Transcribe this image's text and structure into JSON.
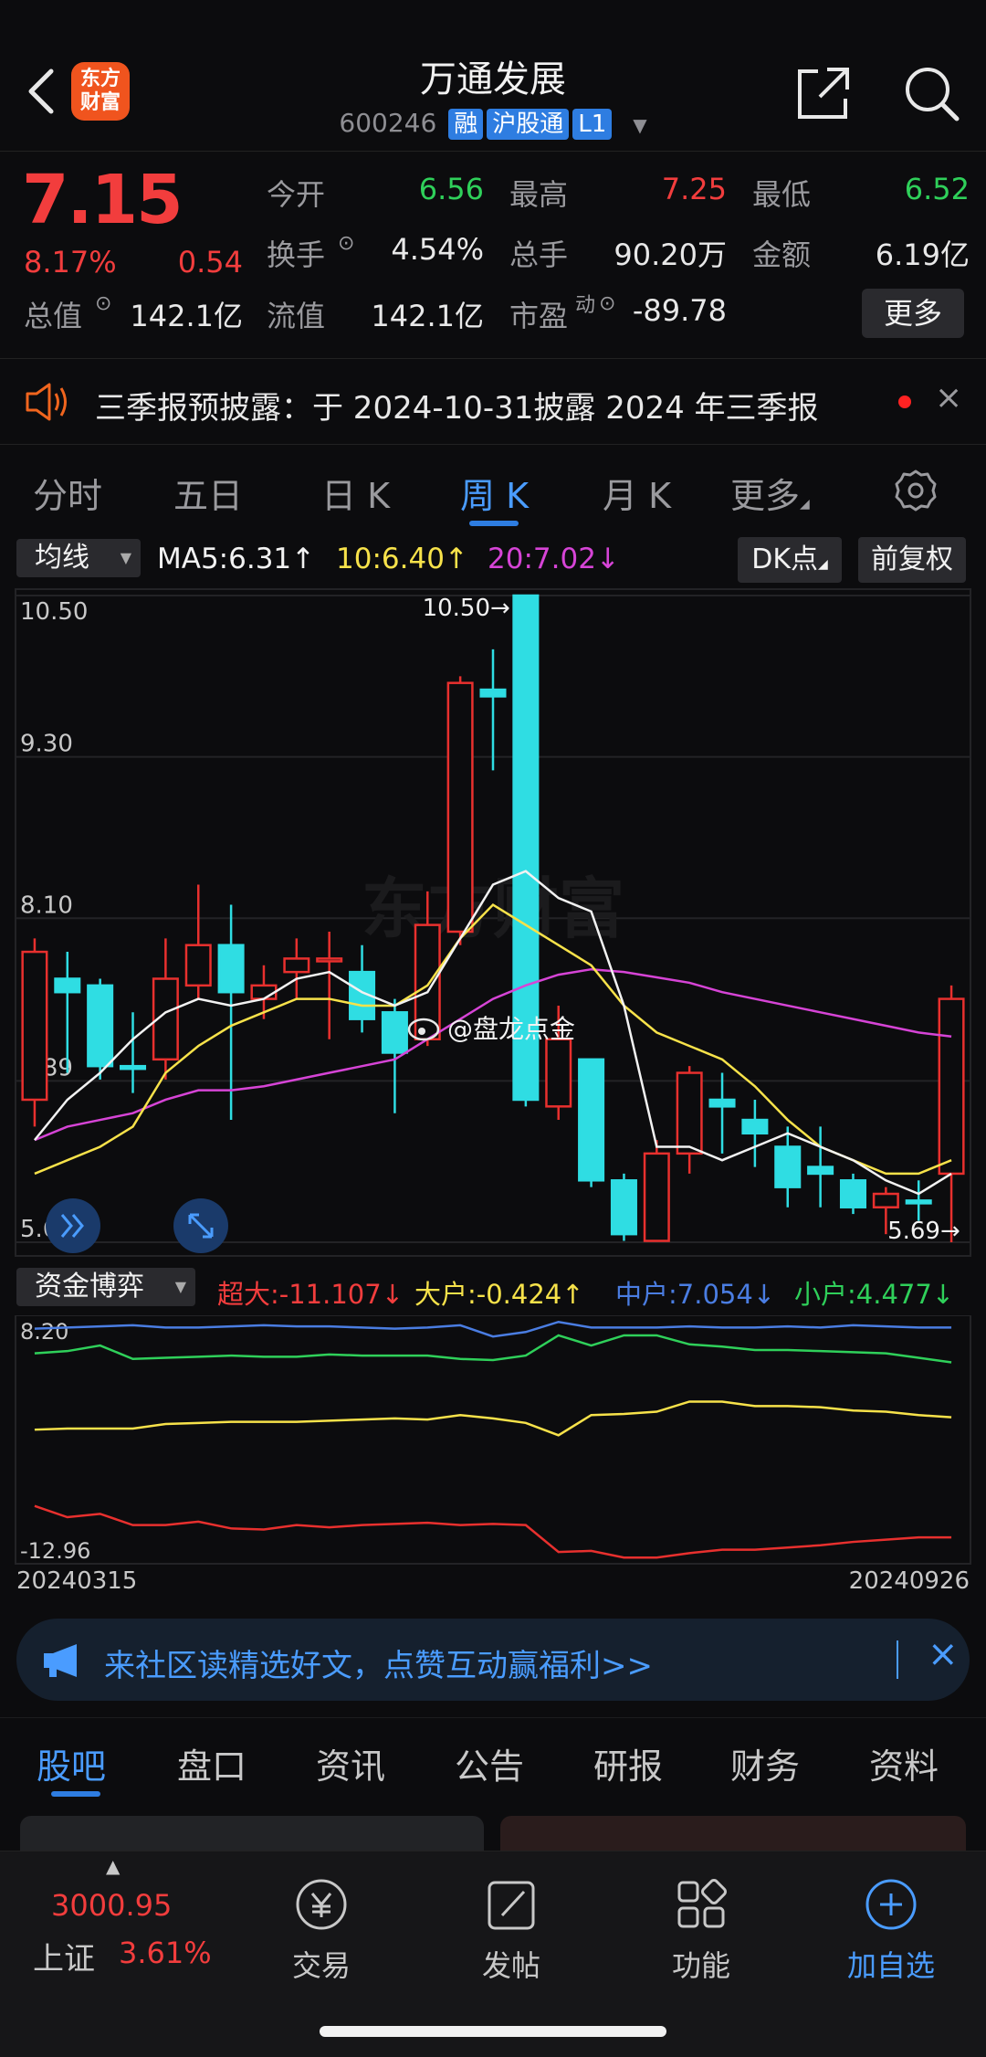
{
  "header": {
    "logo_line1": "东方",
    "logo_line2": "财富",
    "title": "万通发展",
    "code": "600246",
    "tags": [
      "融",
      "沪股通",
      "L1"
    ]
  },
  "quote": {
    "price": "7.15",
    "change_pct": "8.17%",
    "change": "0.54",
    "fields": [
      {
        "label": "今开",
        "value": "6.56",
        "color": "#2fd05a"
      },
      {
        "label": "最高",
        "value": "7.25",
        "color": "#f23d3d"
      },
      {
        "label": "最低",
        "value": "6.52",
        "color": "#2fd05a"
      },
      {
        "label": "换手",
        "value": "4.54%",
        "color": "#e8e8e8"
      },
      {
        "label": "总手",
        "value": "90.20万",
        "color": "#e8e8e8"
      },
      {
        "label": "金额",
        "value": "6.19亿",
        "color": "#e8e8e8"
      },
      {
        "label": "总值",
        "value": "142.1亿",
        "color": "#e8e8e8"
      },
      {
        "label": "流值",
        "value": "142.1亿",
        "color": "#e8e8e8"
      },
      {
        "label": "市盈",
        "value": "-89.78",
        "color": "#e8e8e8"
      }
    ],
    "pe_superscript": "动",
    "more_label": "更多"
  },
  "notice": {
    "text": "三季报预披露：于 2024-10-31披露 2024 年三季报"
  },
  "tabs": [
    {
      "label": "分时"
    },
    {
      "label": "五日"
    },
    {
      "label": "日 K"
    },
    {
      "label": "周 K"
    },
    {
      "label": "月 K"
    },
    {
      "label": "更多"
    }
  ],
  "legend": {
    "dropdown": "均线",
    "ma5": "MA5:6.31↑",
    "ma10": "10:6.40↑",
    "ma20": "20:7.02↓",
    "dk_label": "DK点",
    "adjust_label": "前复权"
  },
  "chart_data": {
    "type": "candlestick",
    "ylim": [
      5.69,
      10.5
    ],
    "y_ticks": [
      "10.50",
      "9.30",
      "8.10",
      "6.89",
      "5.69"
    ],
    "max_label": "10.50→",
    "min_label": "5.69→",
    "watermark": "东方财富",
    "weibo_tag": "@盘龙点金",
    "candles": [
      {
        "o": 6.75,
        "c": 7.85,
        "h": 7.95,
        "l": 6.55
      },
      {
        "o": 7.65,
        "c": 7.55,
        "h": 7.85,
        "l": 6.95
      },
      {
        "o": 7.6,
        "c": 7.0,
        "h": 7.65,
        "l": 6.9
      },
      {
        "o": 7.0,
        "c": 6.98,
        "h": 7.4,
        "l": 6.8
      },
      {
        "o": 7.05,
        "c": 7.65,
        "h": 7.95,
        "l": 6.9
      },
      {
        "o": 7.6,
        "c": 7.9,
        "h": 8.35,
        "l": 7.5
      },
      {
        "o": 7.9,
        "c": 7.55,
        "h": 8.2,
        "l": 6.6
      },
      {
        "o": 7.5,
        "c": 7.6,
        "h": 7.75,
        "l": 7.35
      },
      {
        "o": 7.7,
        "c": 7.8,
        "h": 7.95,
        "l": 7.5
      },
      {
        "o": 7.8,
        "c": 7.8,
        "h": 8.0,
        "l": 7.2
      },
      {
        "o": 7.7,
        "c": 7.35,
        "h": 7.9,
        "l": 7.25
      },
      {
        "o": 7.4,
        "c": 7.1,
        "h": 7.5,
        "l": 6.65
      },
      {
        "o": 7.2,
        "c": 8.05,
        "h": 8.3,
        "l": 7.15
      },
      {
        "o": 8.0,
        "c": 9.85,
        "h": 9.9,
        "l": 7.9
      },
      {
        "o": 9.8,
        "c": 9.75,
        "h": 10.1,
        "l": 9.2
      },
      {
        "o": 10.5,
        "c": 6.75,
        "h": 10.5,
        "l": 6.7
      },
      {
        "o": 6.7,
        "c": 7.2,
        "h": 7.45,
        "l": 6.6
      },
      {
        "o": 7.05,
        "c": 6.15,
        "h": 7.05,
        "l": 6.1
      },
      {
        "o": 6.15,
        "c": 5.75,
        "h": 6.2,
        "l": 5.7
      },
      {
        "o": 5.7,
        "c": 6.35,
        "h": 6.45,
        "l": 5.7
      },
      {
        "o": 6.35,
        "c": 6.95,
        "h": 7.0,
        "l": 6.2
      },
      {
        "o": 6.75,
        "c": 6.7,
        "h": 6.95,
        "l": 6.35
      },
      {
        "o": 6.6,
        "c": 6.5,
        "h": 6.75,
        "l": 6.25
      },
      {
        "o": 6.4,
        "c": 6.1,
        "h": 6.55,
        "l": 5.95
      },
      {
        "o": 6.25,
        "c": 6.2,
        "h": 6.55,
        "l": 5.95
      },
      {
        "o": 6.15,
        "c": 5.95,
        "h": 6.2,
        "l": 5.9
      },
      {
        "o": 5.95,
        "c": 6.05,
        "h": 6.1,
        "l": 5.75
      },
      {
        "o": 6.0,
        "c": 5.98,
        "h": 6.15,
        "l": 5.85
      },
      {
        "o": 6.2,
        "c": 7.5,
        "h": 7.6,
        "l": 5.69
      }
    ],
    "ma5": [
      6.45,
      6.75,
      6.95,
      7.2,
      7.4,
      7.5,
      7.45,
      7.5,
      7.65,
      7.7,
      7.55,
      7.45,
      7.55,
      7.95,
      8.35,
      8.45,
      8.25,
      8.15,
      7.45,
      6.4,
      6.4,
      6.3,
      6.4,
      6.5,
      6.4,
      6.3,
      6.15,
      6.05,
      6.2
    ],
    "ma10": [
      6.2,
      6.3,
      6.4,
      6.55,
      6.95,
      7.15,
      7.3,
      7.4,
      7.5,
      7.5,
      7.45,
      7.45,
      7.6,
      7.95,
      8.2,
      8.05,
      7.9,
      7.75,
      7.45,
      7.25,
      7.15,
      7.05,
      6.85,
      6.6,
      6.4,
      6.3,
      6.2,
      6.2,
      6.3
    ],
    "ma20": [
      6.45,
      6.55,
      6.6,
      6.65,
      6.75,
      6.82,
      6.82,
      6.85,
      6.9,
      6.95,
      7.0,
      7.05,
      7.2,
      7.35,
      7.5,
      7.6,
      7.68,
      7.72,
      7.7,
      7.66,
      7.62,
      7.55,
      7.5,
      7.45,
      7.4,
      7.35,
      7.3,
      7.25,
      7.22
    ]
  },
  "fund": {
    "dropdown": "资金博弈",
    "super": "超大:-11.107↓",
    "large": "大户:-0.424↑",
    "medium": "中户:7.054↓",
    "small": "小户:4.477↓",
    "y_top": "8.20",
    "y_bottom": "-12.96",
    "date_start": "20240315",
    "date_end": "20240926",
    "lines": {
      "medium": [
        7.5,
        7.6,
        7.7,
        7.8,
        7.6,
        7.6,
        7.7,
        7.8,
        7.7,
        7.7,
        7.6,
        7.5,
        7.6,
        7.8,
        6.8,
        7.2,
        8.1,
        7.6,
        7.6,
        7.6,
        7.7,
        7.6,
        7.6,
        7.7,
        7.6,
        7.8,
        7.7,
        7.6,
        7.6
      ],
      "small": [
        5.3,
        5.5,
        6.0,
        4.8,
        4.9,
        5.0,
        5.1,
        5.0,
        5.0,
        5.2,
        5.1,
        5.1,
        5.1,
        4.8,
        4.7,
        5.1,
        6.9,
        6.0,
        6.9,
        6.9,
        6.1,
        5.9,
        5.6,
        5.6,
        5.5,
        5.4,
        5.3,
        4.9,
        4.5
      ],
      "large": [
        -1.5,
        -1.4,
        -1.4,
        -1.4,
        -1.0,
        -0.9,
        -0.8,
        -0.8,
        -0.8,
        -0.7,
        -0.6,
        -0.5,
        -0.6,
        -0.2,
        -0.5,
        -0.9,
        -2.0,
        -0.2,
        -0.1,
        0.1,
        1.0,
        1.0,
        0.6,
        0.6,
        0.5,
        0.2,
        0.1,
        -0.2,
        -0.4
      ],
      "super": [
        -8.3,
        -9.3,
        -9.0,
        -10.0,
        -10.0,
        -9.7,
        -10.3,
        -10.4,
        -10.0,
        -10.2,
        -10.0,
        -9.9,
        -9.8,
        -10.0,
        -9.9,
        -10.0,
        -12.4,
        -12.3,
        -12.9,
        -12.9,
        -12.5,
        -12.2,
        -12.2,
        -12.0,
        -11.8,
        -11.5,
        -11.3,
        -11.1,
        -11.1
      ]
    }
  },
  "banner": {
    "text": "来社区读精选好文，点赞互动赢福利>>"
  },
  "bottom_tabs": [
    "股吧",
    "盘口",
    "资讯",
    "公告",
    "研报",
    "财务",
    "资料"
  ],
  "dock": {
    "index_value": "3000.95",
    "index_name": "上证",
    "index_pct": "3.61%",
    "items": [
      {
        "label": "交易",
        "icon": "yen-icon"
      },
      {
        "label": "发帖",
        "icon": "compose-icon"
      },
      {
        "label": "功能",
        "icon": "grid-icon"
      },
      {
        "label": "加自选",
        "icon": "add-circle-icon"
      }
    ]
  }
}
